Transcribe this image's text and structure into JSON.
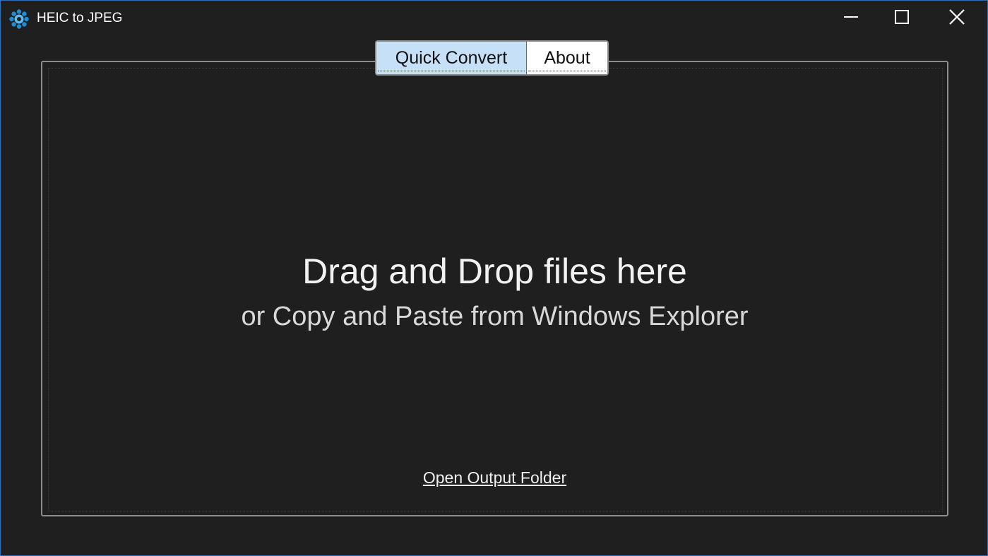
{
  "window": {
    "title": "HEIC to JPEG",
    "icon": "gear-icon",
    "controls": {
      "minimize": "minimize-icon",
      "maximize": "maximize-icon",
      "close": "close-icon"
    }
  },
  "tabs": [
    {
      "label": "Quick Convert",
      "active": true
    },
    {
      "label": "About",
      "active": false
    }
  ],
  "dropzone": {
    "headline": "Drag and Drop files here",
    "subline": "or Copy and Paste from Windows Explorer",
    "link": "Open Output Folder"
  },
  "colors": {
    "background": "#1f1f1f",
    "active_tab": "#c6e1f7",
    "frame_border": "#8c8c8c",
    "window_border": "#2d6fb5",
    "icon_accent": "#1e8fd6"
  }
}
